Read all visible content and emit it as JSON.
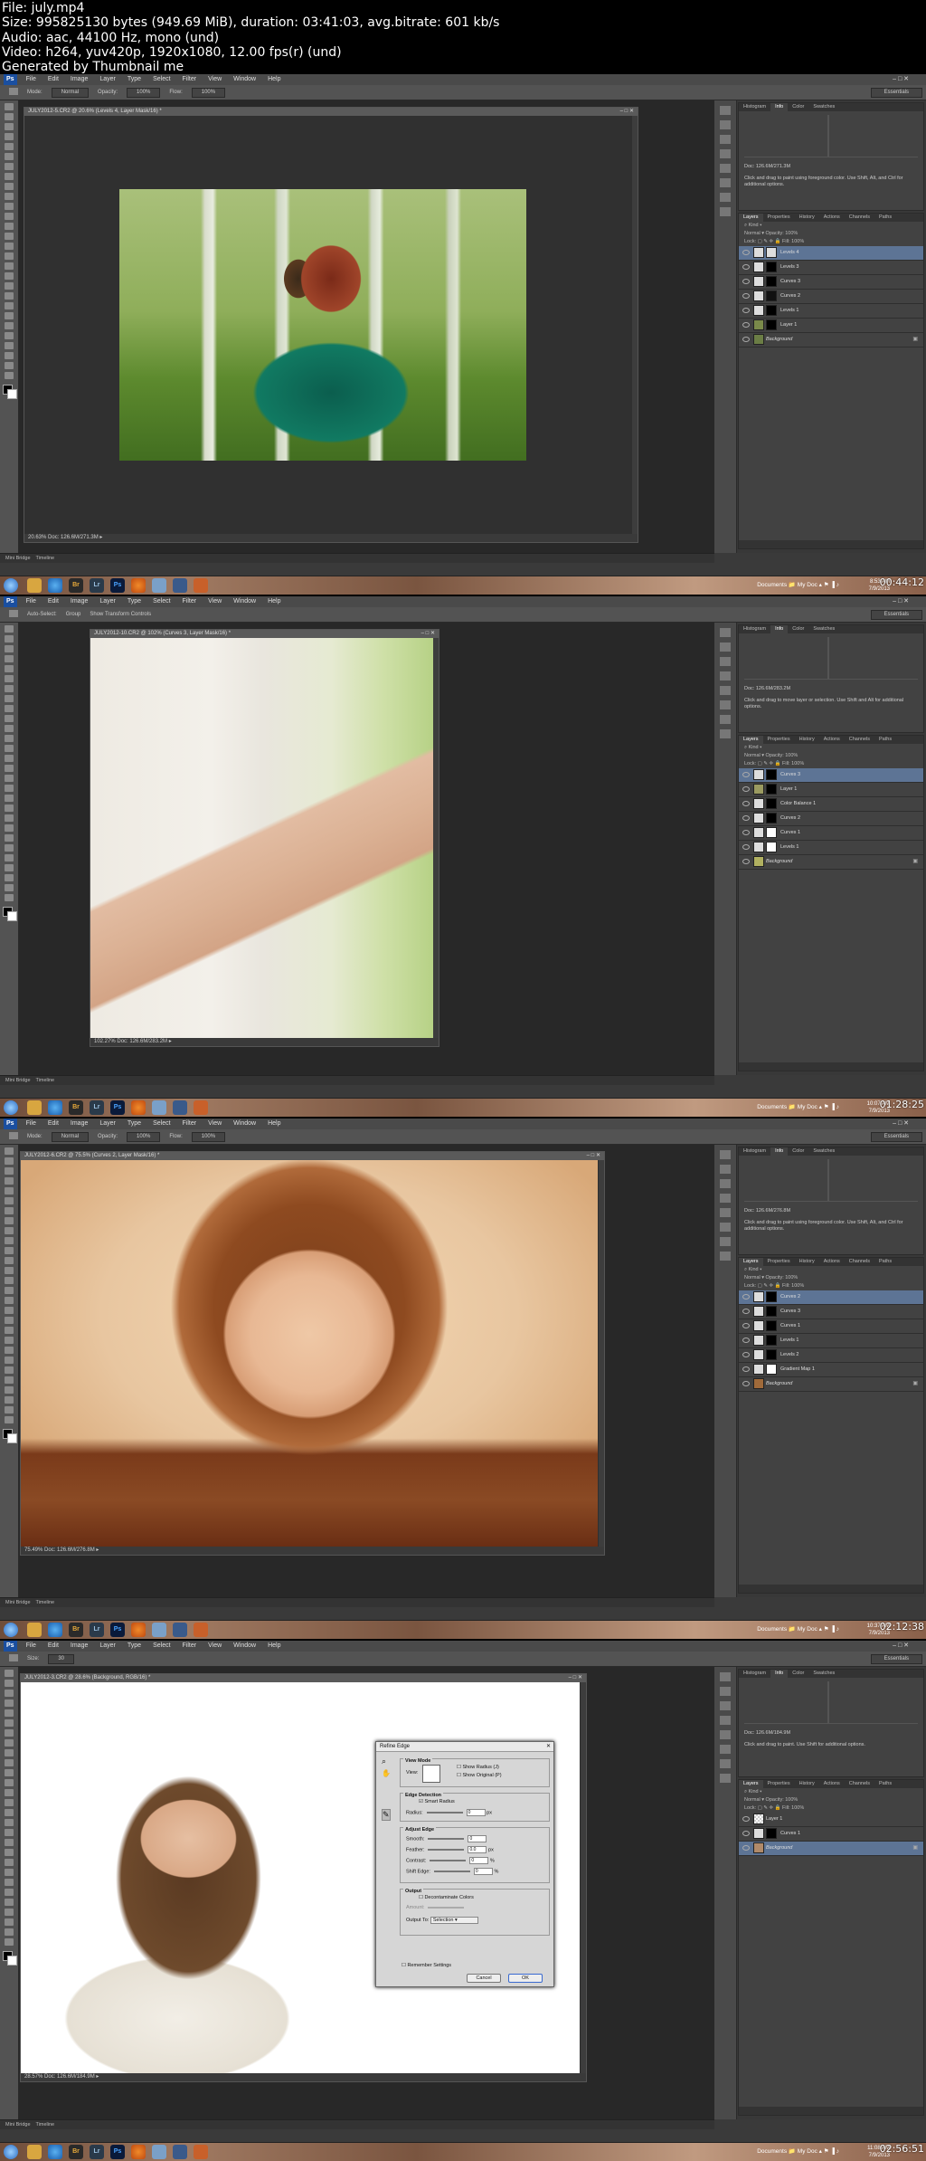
{
  "header": {
    "file": "File: july.mp4",
    "size": "Size: 995825130 bytes (949.69 MiB), duration: 03:41:03, avg.bitrate: 601 kb/s",
    "audio": "Audio: aac, 44100 Hz, mono (und)",
    "video": "Video: h264, yuv420p, 1920x1080, 12.00 fps(r) (und)",
    "generator": "Generated by Thumbnail me"
  },
  "app": {
    "logo": "Ps",
    "menu": [
      "File",
      "Edit",
      "Image",
      "Layer",
      "Type",
      "Select",
      "Filter",
      "View",
      "Window",
      "Help"
    ],
    "essentials": "Essentials",
    "mini_bridge": "Mini Bridge",
    "timeline": "Timeline",
    "info_tabs": [
      "Histogram",
      "Info",
      "Color",
      "Swatches"
    ],
    "layer_tabs": [
      "Layers",
      "Properties",
      "History",
      "Actions",
      "Channels",
      "Paths"
    ],
    "blend_mode": "Normal",
    "opacity_label": "Opacity:",
    "opacity_value": "100%",
    "fill_label": "Fill:",
    "fill_value": "100%",
    "lock_label": "Lock:",
    "kind_label": "Kind",
    "tray_documents": "Documents",
    "tray_mydoc": "My Doc"
  },
  "frames": [
    {
      "timestamp": "00:44:12",
      "clock_time": "8:53 AM",
      "clock_date": "7/9/2013",
      "options": [
        "Mode:",
        "Normal",
        "Opacity:",
        "100%",
        "Flow:",
        "100%"
      ],
      "doc_title": "JULY2012-5.CR2 @ 20.6% (Levels 4, Layer Mask/16) *",
      "zoom": "20.63%",
      "doc_info": "Doc: 126.6M/271.3M",
      "info_doc": "Doc: 126.6M/271.3M",
      "info_text": "Click and drag to paint using foreground color.  Use Shift, Alt, and Ctrl for additional options.",
      "layers": [
        {
          "name": "Levels 4",
          "selected": true,
          "thumb": "#ddd",
          "mask": "#ddd"
        },
        {
          "name": "Levels 3",
          "selected": false,
          "thumb": "#ddd",
          "mask": "#000"
        },
        {
          "name": "Curves 3",
          "selected": false,
          "thumb": "#ddd",
          "mask": "#000"
        },
        {
          "name": "Curves 2",
          "selected": false,
          "thumb": "#ddd",
          "mask": "#111"
        },
        {
          "name": "Levels 1",
          "selected": false,
          "thumb": "#ddd",
          "mask": "#000"
        },
        {
          "name": "Layer 1",
          "selected": false,
          "thumb": "#7a8a4a",
          "mask": "#000"
        },
        {
          "name": "Background",
          "selected": false,
          "thumb": "#6b7d45",
          "mask": "",
          "locked": true
        }
      ]
    },
    {
      "timestamp": "01:28:25",
      "clock_time": "10:07 AM",
      "clock_date": "7/9/2013",
      "options": [
        "Auto-Select:",
        "Group",
        "Show Transform Controls"
      ],
      "doc_title": "JULY2012-10.CR2 @ 102% (Curves 3, Layer Mask/16) *",
      "zoom": "102.27%",
      "doc_info": "Doc: 126.6M/283.2M",
      "info_doc": "Doc: 126.6M/283.2M",
      "info_text": "Click and drag to move layer or selection.  Use Shift and Alt for additional options.",
      "layers": [
        {
          "name": "Curves 3",
          "selected": true,
          "thumb": "#ddd",
          "mask": "#000"
        },
        {
          "name": "Layer 1",
          "selected": false,
          "thumb": "#9a9a60",
          "mask": "#000"
        },
        {
          "name": "Color Balance 1",
          "selected": false,
          "thumb": "#ddd",
          "mask": "#000"
        },
        {
          "name": "Curves 2",
          "selected": false,
          "thumb": "#ddd",
          "mask": "#000"
        },
        {
          "name": "Curves 1",
          "selected": false,
          "thumb": "#ddd",
          "mask": "#fff"
        },
        {
          "name": "Levels 1",
          "selected": false,
          "thumb": "#ddd",
          "mask": "#fff"
        },
        {
          "name": "Background",
          "selected": false,
          "thumb": "#b0b060",
          "mask": "",
          "locked": true
        }
      ]
    },
    {
      "timestamp": "02:12:38",
      "clock_time": "10:37 AM",
      "clock_date": "7/9/2013",
      "options": [
        "Mode:",
        "Normal",
        "Opacity:",
        "100%",
        "Flow:",
        "100%"
      ],
      "doc_title": "JULY2012-6.CR2 @ 75.5% (Curves 2, Layer Mask/16) *",
      "zoom": "75.49%",
      "doc_info": "Doc: 126.6M/276.8M",
      "info_doc": "Doc: 126.6M/276.8M",
      "info_text": "Click and drag to paint using foreground color.  Use Shift, Alt, and Ctrl for additional options.",
      "layers": [
        {
          "name": "Curves 2",
          "selected": true,
          "thumb": "#ddd",
          "mask": "#000"
        },
        {
          "name": "Curves 3",
          "selected": false,
          "thumb": "#ddd",
          "mask": "#000"
        },
        {
          "name": "Curves 1",
          "selected": false,
          "thumb": "#ddd",
          "mask": "#000"
        },
        {
          "name": "Levels 1",
          "selected": false,
          "thumb": "#ddd",
          "mask": "#000"
        },
        {
          "name": "Levels 2",
          "selected": false,
          "thumb": "#ddd",
          "mask": "#000"
        },
        {
          "name": "Gradient Map 1",
          "selected": false,
          "thumb": "#ddd",
          "mask": "#fff"
        },
        {
          "name": "Background",
          "selected": false,
          "thumb": "#a06a3a",
          "mask": "",
          "locked": true
        }
      ]
    },
    {
      "timestamp": "02:56:51",
      "clock_time": "11:08 AM",
      "clock_date": "7/9/2013",
      "options": [
        "Size:",
        "30"
      ],
      "doc_title": "JULY2012-3.CR2 @ 28.6% (Background, RGB/16) *",
      "zoom": "28.57%",
      "doc_info": "Doc: 126.6M/184.9M",
      "info_doc": "Doc: 126.6M/184.9M",
      "info_text": "Click and drag to paint.  Use Shift for additional options.",
      "layers": [
        {
          "name": "Layer 1",
          "selected": false,
          "thumb": "#eee",
          "mask": "",
          "checker": true
        },
        {
          "name": "Curves 1",
          "selected": false,
          "thumb": "#ddd",
          "mask": "#000"
        },
        {
          "name": "Background",
          "selected": true,
          "thumb": "#b08a6a",
          "mask": "",
          "locked": true
        }
      ],
      "dialog": {
        "title": "Refine Edge",
        "view_mode": "View Mode",
        "view_label": "View:",
        "show_radius": "Show Radius (J)",
        "show_original": "Show Original (P)",
        "edge_detection": "Edge Detection",
        "smart_radius": "Smart Radius",
        "radius_label": "Radius:",
        "radius_value": "0",
        "radius_unit": "px",
        "adjust_edge": "Adjust Edge",
        "smooth_label": "Smooth:",
        "smooth_value": "0",
        "feather_label": "Feather:",
        "feather_value": "0.0",
        "feather_unit": "px",
        "contrast_label": "Contrast:",
        "contrast_value": "0",
        "contrast_unit": "%",
        "shift_label": "Shift Edge:",
        "shift_value": "0",
        "shift_unit": "%",
        "output": "Output",
        "decontaminate": "Decontaminate Colors",
        "amount_label": "Amount:",
        "output_to_label": "Output To:",
        "output_to_value": "Selection",
        "remember": "Remember Settings",
        "cancel": "Cancel",
        "ok": "OK"
      }
    }
  ]
}
